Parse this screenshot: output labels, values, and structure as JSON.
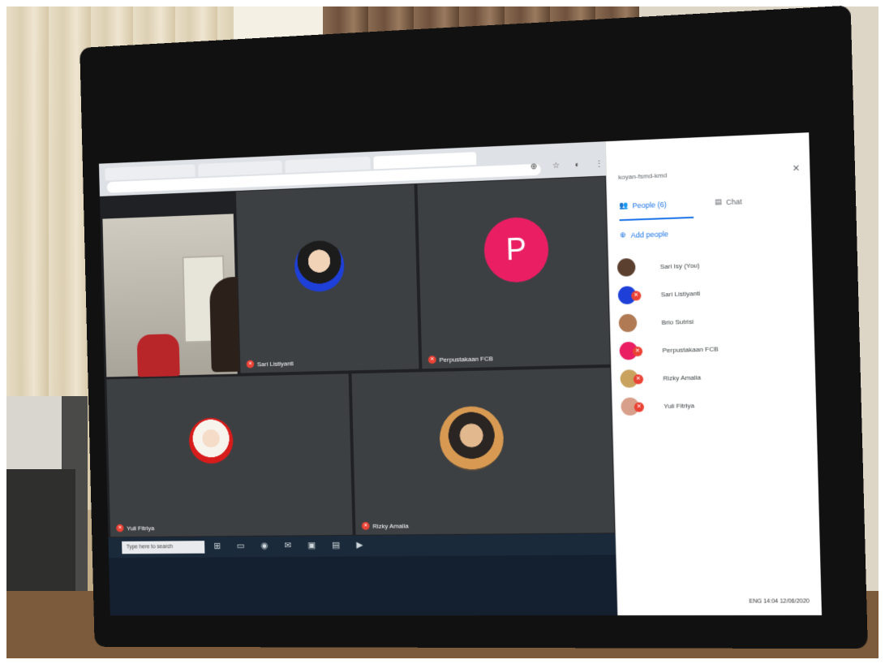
{
  "browser": {
    "tabs": [
      "",
      "",
      "",
      ""
    ],
    "address": "",
    "toolbar_icons": "⊕ ☆ ◐ ⋮"
  },
  "meet": {
    "tiles": [
      {
        "name": "",
        "type": "camera"
      },
      {
        "name": "Sari Listiyanti",
        "type": "photo",
        "ring_color": "#1e3fd8"
      },
      {
        "name": "Perpustakaan FCB",
        "type": "letter",
        "letter": "P",
        "color": "#e91e63"
      },
      {
        "name": "Yuli Fitriya",
        "type": "photo",
        "ring_color": "#d81b1b"
      },
      {
        "name": "Rizky Amalia",
        "type": "photo",
        "ring_color": "#5a4b3d"
      }
    ]
  },
  "panel": {
    "meeting_code": "koyan-fsmd-kmd",
    "close": "×",
    "tab_people": "People (6)",
    "tab_chat": "Chat",
    "add_people": "Add people",
    "people": [
      {
        "name": "Sari Isy (You)",
        "color": "#5b4030"
      },
      {
        "name": "Sari Listiyanti",
        "color": "#1e3fd8"
      },
      {
        "name": "Brio Sutrisi",
        "color": "#b07a55"
      },
      {
        "name": "Perpustakaan FCB",
        "color": "#e91e63"
      },
      {
        "name": "Rizky Amalia",
        "color": "#c9a25e"
      },
      {
        "name": "Yuli Fitriya",
        "color": "#d8a08a"
      }
    ]
  },
  "taskbar": {
    "search": "Type here to search",
    "icons": "⊞ ▭ ◉ ✉ ▣ ▤ ▶",
    "tray_time": "14:04",
    "tray_date": "12/06/2020",
    "tray_lang": "ENG"
  }
}
